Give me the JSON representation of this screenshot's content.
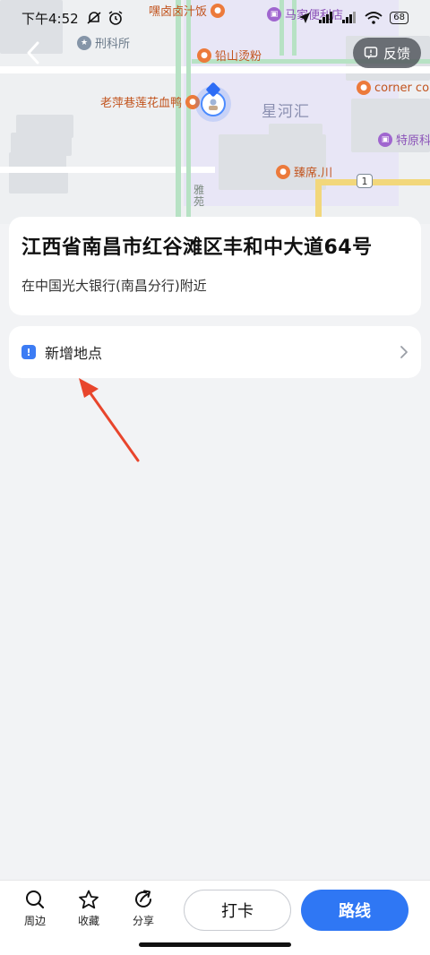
{
  "status_bar": {
    "time": "下午4:52",
    "battery": "68"
  },
  "map": {
    "pois": {
      "station": "刑科所",
      "restaurant_top": "嘿卤卤汁饭",
      "store_top": "马家便利店",
      "snack": "铅山烫粉",
      "duck": "老萍巷莲花血鸭",
      "corner": "corner co",
      "special": "特原科",
      "zhen": "臻席.川"
    },
    "area_label": "星河汇",
    "road_label": "雅苑",
    "route_number": "1"
  },
  "header": {
    "feedback_label": "反馈"
  },
  "address": {
    "title": "江西省南昌市红谷滩区丰和中大道64号",
    "nearby": "在中国光大银行(南昌分行)附近"
  },
  "add_place": {
    "label": "新增地点"
  },
  "toolbar": {
    "nearby": "周边",
    "favorite": "收藏",
    "share": "分享",
    "checkin": "打卡",
    "route": "路线"
  },
  "colors": {
    "accent": "#2f77f4",
    "annotation_arrow": "#e8452c"
  }
}
